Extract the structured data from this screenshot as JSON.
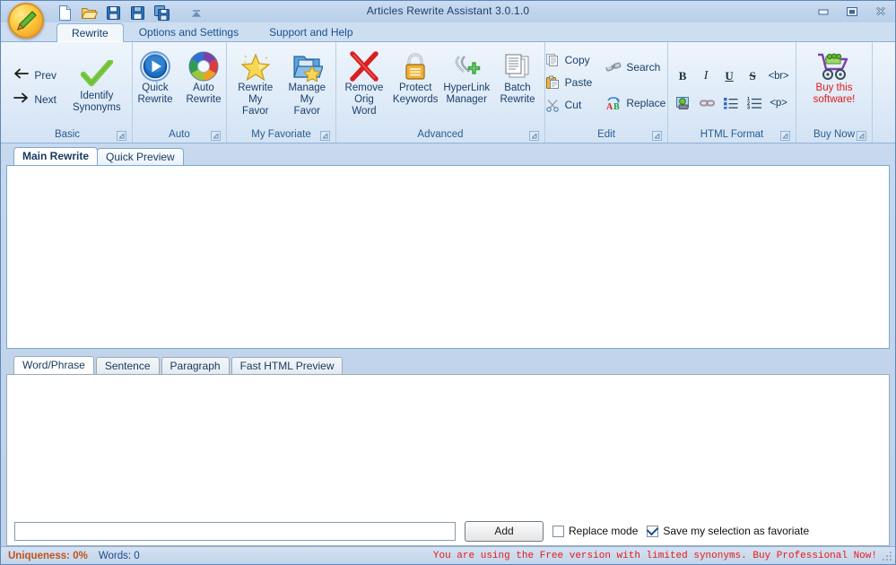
{
  "window": {
    "title": "Articles Rewrite Assistant 3.0.1.0",
    "controls": {
      "minimize": "minimize-button",
      "maximize": "maximize-button",
      "close": "close-button"
    }
  },
  "quick_access": {
    "items": [
      {
        "name": "new-icon",
        "label": "New"
      },
      {
        "name": "open-icon",
        "label": "Open"
      },
      {
        "name": "save-icon",
        "label": "Save"
      },
      {
        "name": "save-as-icon",
        "label": "Save As"
      },
      {
        "name": "save-all-icon",
        "label": "Save All"
      },
      {
        "name": "customize-quick-access-icon",
        "label": "Customize Quick Access Toolbar"
      }
    ]
  },
  "ribbon": {
    "tabs": [
      {
        "label": "Rewrite",
        "active": true
      },
      {
        "label": "Options and Settings",
        "active": false
      },
      {
        "label": "Support and Help",
        "active": false
      }
    ],
    "groups": [
      {
        "label": "Basic",
        "buttons": [
          {
            "label": "Prev",
            "icon": "arrow-left-icon"
          },
          {
            "label": "Next",
            "icon": "arrow-right-icon"
          },
          {
            "label": "Identify\nSynonyms",
            "icon": "green-check-icon"
          }
        ]
      },
      {
        "label": "Auto",
        "buttons": [
          {
            "label": "Quick\nRewrite",
            "icon": "play-circle-icon"
          },
          {
            "label": "Auto\nRewrite",
            "icon": "color-wheel-icon"
          }
        ]
      },
      {
        "label": "My Favoriate",
        "buttons": [
          {
            "label": "Rewrite\nMy Favor",
            "icon": "star-icon"
          },
          {
            "label": "Manage\nMy Favor",
            "icon": "folder-star-icon"
          }
        ]
      },
      {
        "label": "Advanced",
        "buttons": [
          {
            "label": "Remove\nOrig Word",
            "icon": "red-x-icon"
          },
          {
            "label": "Protect\nKeywords",
            "icon": "padlock-icon"
          },
          {
            "label": "HyperLink\nManager",
            "icon": "link-plus-icon"
          },
          {
            "label": "Batch\nRewrite",
            "icon": "documents-icon"
          }
        ]
      },
      {
        "label": "Edit",
        "buttons": [
          {
            "label": "Copy",
            "icon": "copy-icon"
          },
          {
            "label": "Paste",
            "icon": "paste-icon"
          },
          {
            "label": "Cut",
            "icon": "scissors-icon"
          },
          {
            "label": "Search",
            "icon": "binoculars-icon"
          },
          {
            "label": "Replace",
            "icon": "replace-ab-icon"
          }
        ]
      },
      {
        "label": "HTML Format",
        "buttons": [
          {
            "label": "B",
            "icon": "bold-icon"
          },
          {
            "label": "I",
            "icon": "italic-icon"
          },
          {
            "label": "U",
            "icon": "underline-icon"
          },
          {
            "label": "S",
            "icon": "strikethrough-icon"
          },
          {
            "label": "<br>",
            "icon": "line-break-icon"
          },
          {
            "label": "",
            "icon": "insert-image-icon"
          },
          {
            "label": "",
            "icon": "insert-link-icon"
          },
          {
            "label": "",
            "icon": "bullet-list-icon"
          },
          {
            "label": "",
            "icon": "numbered-list-icon"
          },
          {
            "label": "<p>",
            "icon": "paragraph-tag-icon"
          }
        ]
      },
      {
        "label": "Buy Now",
        "buttons": [
          {
            "label": "Buy this\nsoftware!",
            "icon": "shopping-cart-icon"
          }
        ]
      }
    ]
  },
  "main_tabs": [
    {
      "label": "Main Rewrite",
      "active": true
    },
    {
      "label": "Quick Preview",
      "active": false
    }
  ],
  "editor": {
    "value": ""
  },
  "lower_tabs": [
    {
      "label": "Word/Phrase",
      "active": true
    },
    {
      "label": "Sentence",
      "active": false
    },
    {
      "label": "Paragraph",
      "active": false
    },
    {
      "label": "Fast HTML Preview",
      "active": false
    }
  ],
  "input_row": {
    "field_value": "",
    "field_placeholder": "",
    "add_label": "Add",
    "replace_mode": {
      "label": "Replace mode",
      "checked": false
    },
    "save_favoriate": {
      "label": "Save my selection as favoriate",
      "checked": true
    }
  },
  "status_bar": {
    "uniqueness": "Uniqueness: 0%",
    "words": "Words: 0",
    "nag": "You are using the Free version with limited synonyms. Buy Professional Now!"
  },
  "colors": {
    "accent": "#1b4a8a",
    "nag_red": "#e81818",
    "uniqueness_orange": "#c0531b",
    "buy_red": "#e01b1b"
  }
}
